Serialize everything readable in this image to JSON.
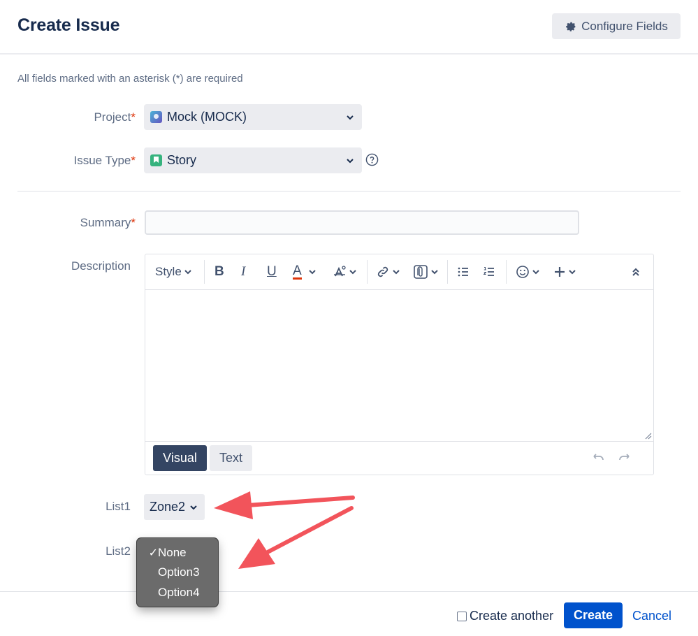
{
  "dialog": {
    "title": "Create Issue",
    "configure_label": "Configure Fields"
  },
  "required_note": "All fields marked with an asterisk (*) are required",
  "fields": {
    "project": {
      "label": "Project",
      "required_mark": "*",
      "value": "Mock (MOCK)"
    },
    "issue_type": {
      "label": "Issue Type",
      "required_mark": "*",
      "value": "Story"
    },
    "summary": {
      "label": "Summary",
      "required_mark": "*",
      "value": ""
    },
    "description": {
      "label": "Description"
    },
    "list1": {
      "label": "List1",
      "value": "Zone2"
    },
    "list2": {
      "label": "List2",
      "options": [
        {
          "label": "None",
          "check": "✓"
        },
        {
          "label": "Option3",
          "check": ""
        },
        {
          "label": "Option4",
          "check": ""
        }
      ]
    }
  },
  "editor": {
    "style_label": "Style",
    "bold_glyph": "B",
    "italic_glyph": "I",
    "underline_glyph": "U",
    "text_color_glyph": "A",
    "visual_label": "Visual",
    "text_label": "Text"
  },
  "footer": {
    "create_another": "Create another",
    "create_label": "Create",
    "cancel_label": "Cancel"
  },
  "colors": {
    "primary": "#0052cc",
    "required": "#de350b",
    "arrow": "#f2545b",
    "visual_active": "#344563"
  },
  "icons": [
    "gear-icon",
    "chevron-down-icon",
    "help-icon",
    "link-icon",
    "attachment-icon",
    "bullet-list-icon",
    "numbered-list-icon",
    "emoji-icon",
    "plus-icon",
    "collapse-icon",
    "undo-icon",
    "redo-icon"
  ]
}
